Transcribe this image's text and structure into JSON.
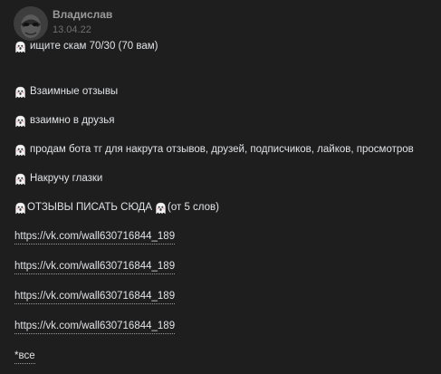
{
  "post": {
    "author": "Владислав",
    "date": "13.04.22",
    "lines": {
      "l1": "ищите скам 70/30 (70 вам)",
      "l2": "Взаимные отзывы",
      "l3": "взаимно в друзья",
      "l4": "продам бота тг для накрута отзывов, друзей, подписчиков, лайков, просмотров",
      "l5": "Накручу глазки",
      "l6a": "ОТЗЫВЫ ПИСАТЬ СЮДА",
      "l6b": "(от 5 слов)"
    },
    "links": [
      "https://vk.com/wall630716844_189",
      "https://vk.com/wall630716844_189",
      "https://vk.com/wall630716844_189",
      "https://vk.com/wall630716844_189"
    ],
    "footer": "*все"
  },
  "colors": {
    "background": "#1e1e1e",
    "text": "#e1e3e6",
    "author": "#9a9a9a",
    "date": "#6f6f6f"
  },
  "icons": {
    "avatar": "dark-masked-avatar",
    "line_emoji": "ghost-icon"
  }
}
